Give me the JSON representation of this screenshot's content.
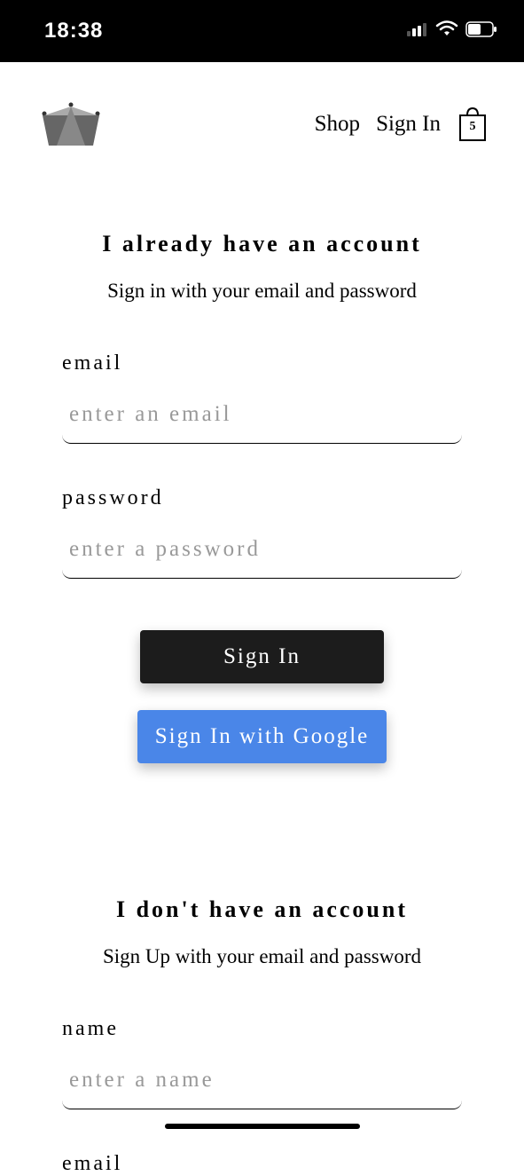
{
  "status": {
    "time": "18:38"
  },
  "nav": {
    "shop": "Shop",
    "signin": "Sign In",
    "cart_count": "5"
  },
  "signin": {
    "title": "I already have an account",
    "subtitle": "Sign in with your email and password",
    "email_label": "email",
    "email_placeholder": "enter an email",
    "password_label": "password",
    "password_placeholder": "enter a password",
    "submit_label": "Sign In",
    "google_label": "Sign In with Google"
  },
  "signup": {
    "title": "I don't have an account",
    "subtitle": "Sign Up with your email and password",
    "name_label": "name",
    "name_placeholder": "enter a name",
    "email_label": "email"
  }
}
